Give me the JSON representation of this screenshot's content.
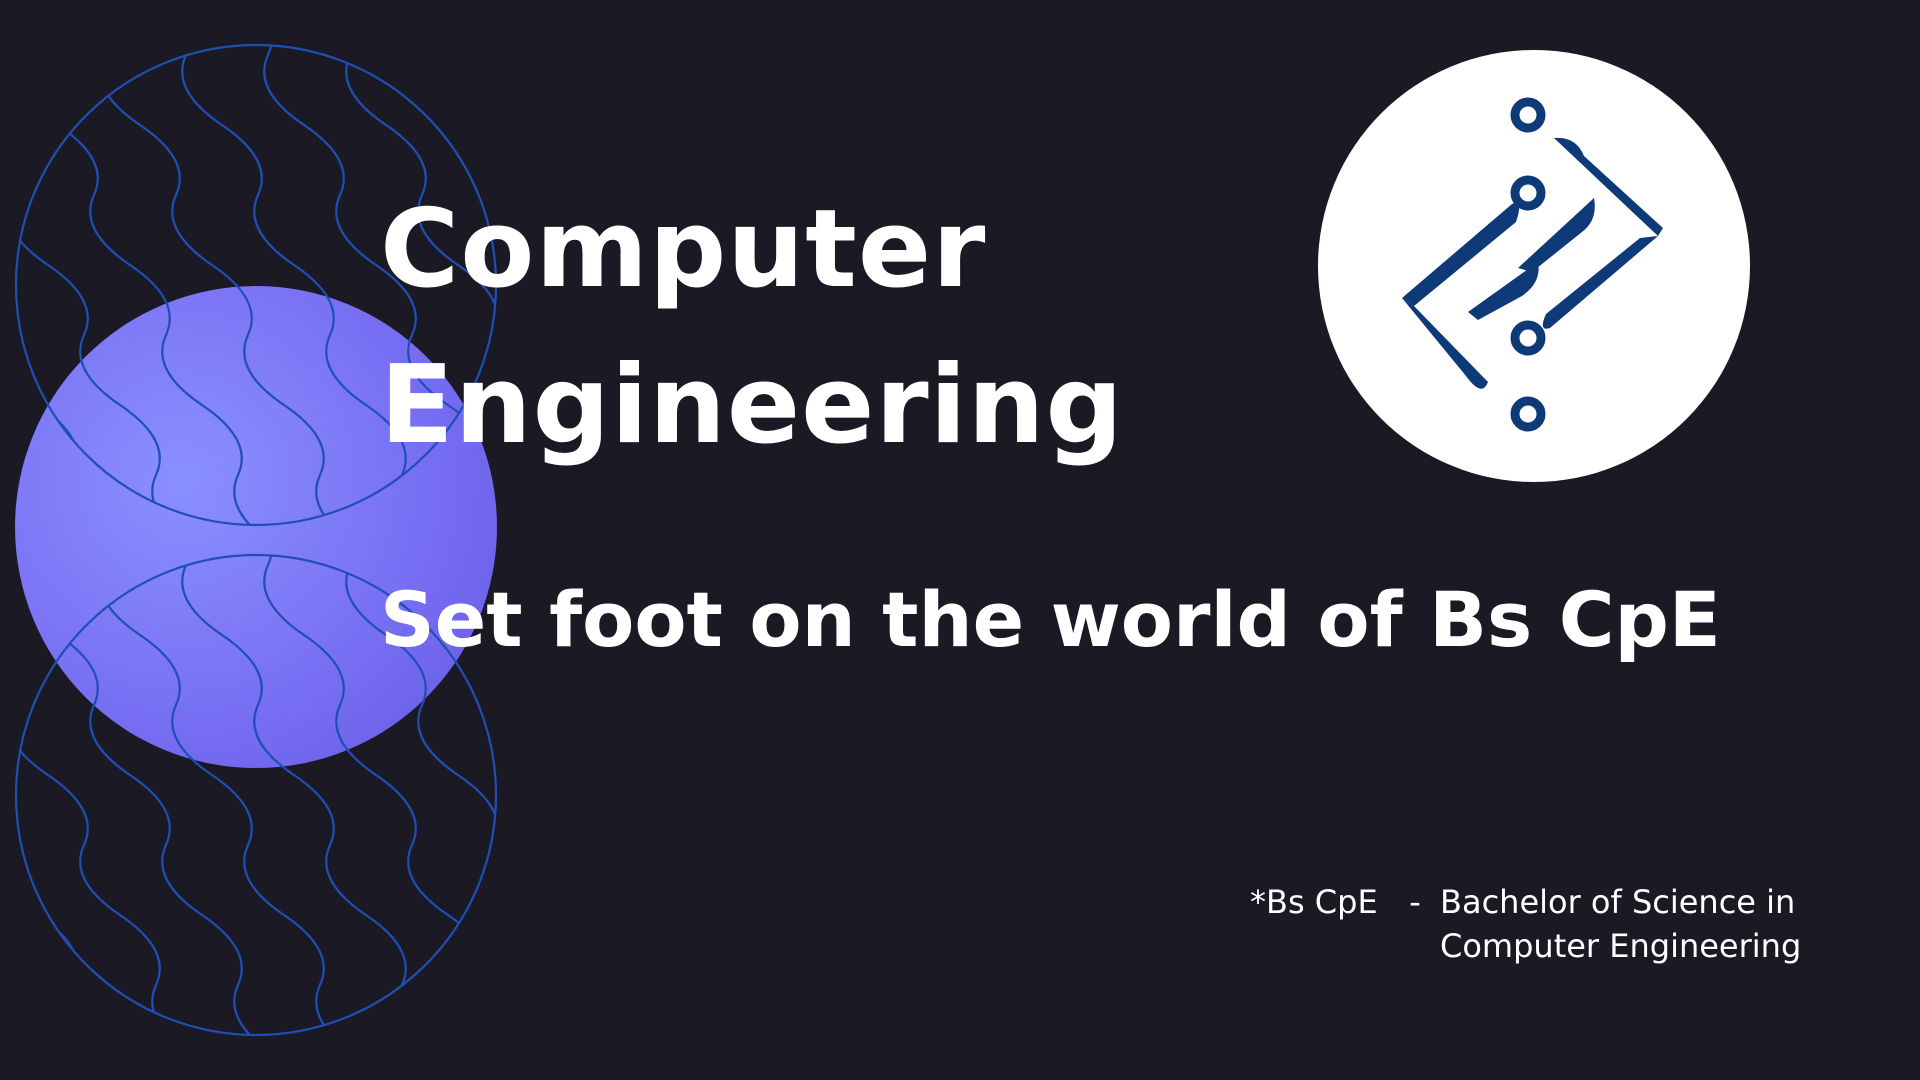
{
  "slide": {
    "title_line1": "Computer",
    "title_line2": "Engineering",
    "subtitle": "Set foot on the world of Bs CpE",
    "footnote": {
      "term": "*Bs CpE",
      "dash": "-",
      "definition_line1": "Bachelor of Science  in",
      "definition_line2": "Computer Engineering"
    }
  },
  "colors": {
    "background": "#1b1a24",
    "accent_circle": "#7a72f5",
    "wave_lines": "#1f4fb5",
    "logo_blue": "#0e3a78",
    "text": "#ffffff"
  },
  "icons": {
    "logo": "circuit-diamond-logo-icon"
  }
}
